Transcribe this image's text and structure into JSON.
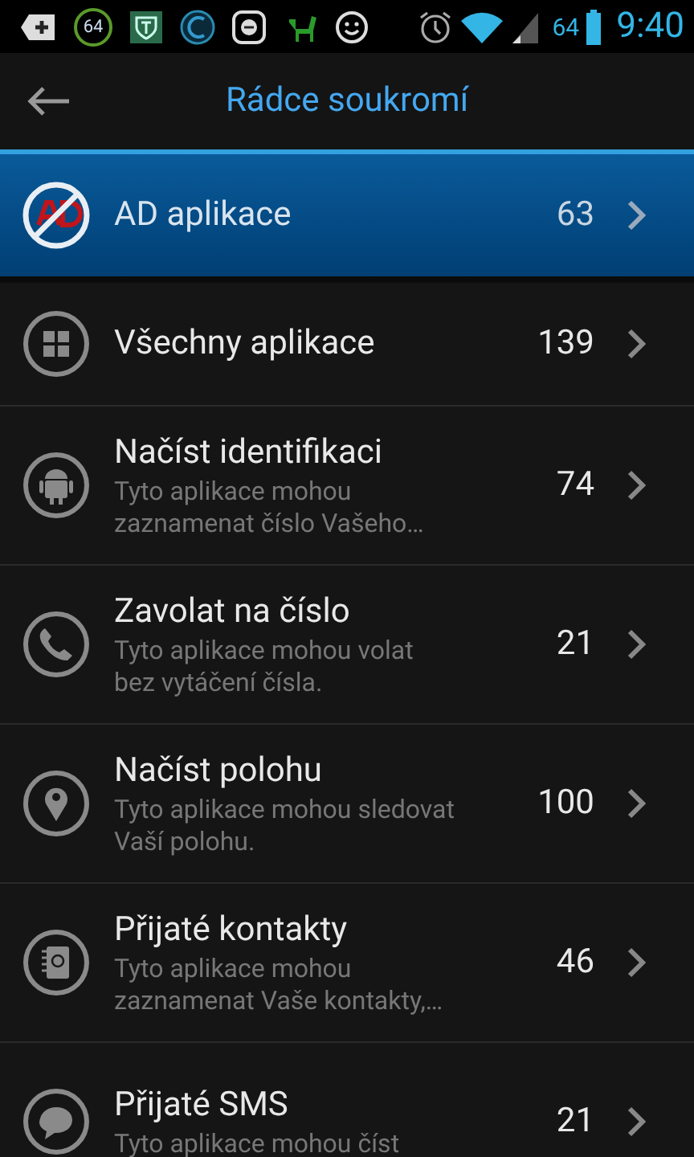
{
  "status_bar": {
    "badge": "64",
    "battery": "64",
    "time": "9:40"
  },
  "app_bar": {
    "title": "Rádce soukromí"
  },
  "items": [
    {
      "kind": "ad",
      "title": "AD aplikace",
      "count": "63",
      "selected": true
    },
    {
      "kind": "grid",
      "title": "Všechny aplikace",
      "count": "139",
      "selected": false
    },
    {
      "kind": "android",
      "title": "Načíst identifikaci",
      "description": "Tyto aplikace mohou zaznamenat číslo Vašeho…",
      "count": "74",
      "selected": false
    },
    {
      "kind": "phone",
      "title": "Zavolat na číslo",
      "description": "Tyto aplikace mohou volat bez vytáčení čísla.",
      "count": "21",
      "selected": false
    },
    {
      "kind": "pin",
      "title": "Načíst polohu",
      "description": "Tyto aplikace mohou sledovat Vaší polohu.",
      "count": "100",
      "selected": false
    },
    {
      "kind": "contacts",
      "title": "Přijaté kontakty",
      "description": "Tyto aplikace mohou zaznamenat Vaše kontakty,…",
      "count": "46",
      "selected": false
    },
    {
      "kind": "chat",
      "title": "Přijaté SMS",
      "description": "Tyto aplikace mohou číst",
      "count": "21",
      "selected": false
    }
  ]
}
